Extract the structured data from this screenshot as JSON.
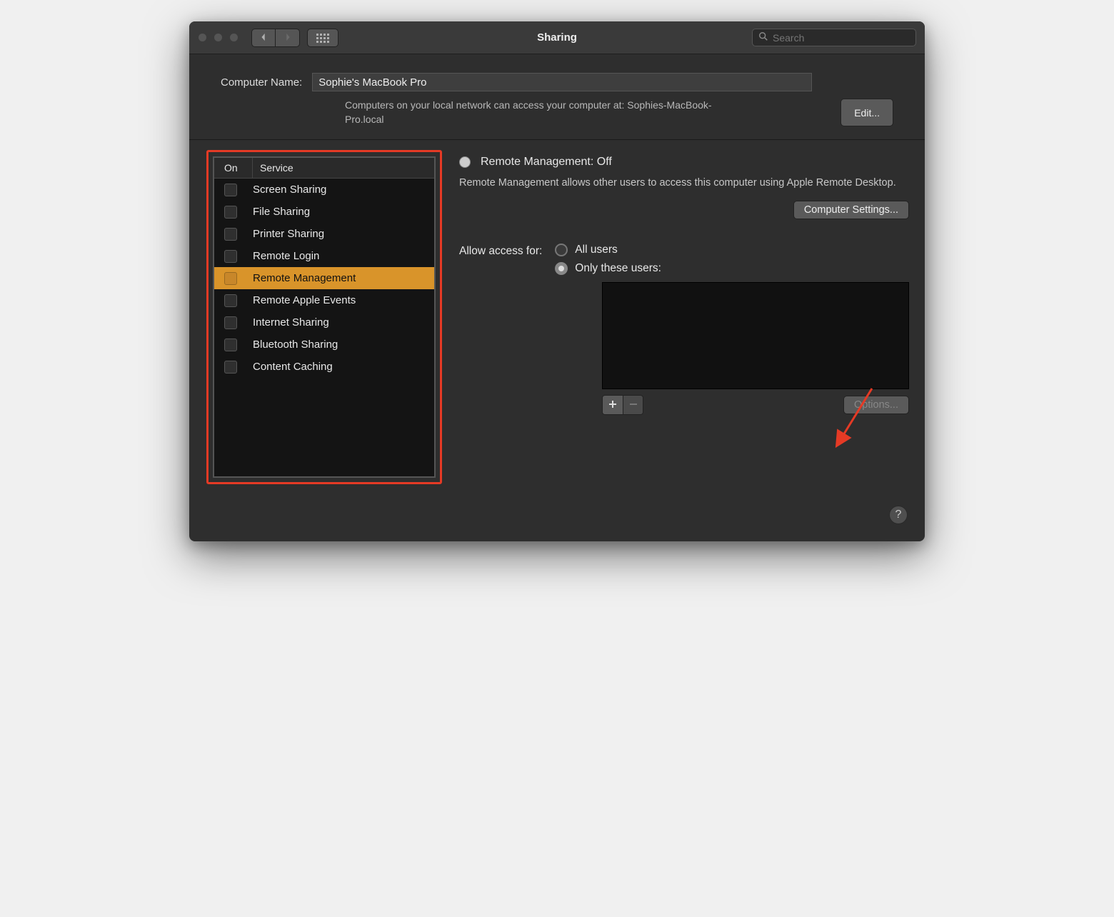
{
  "titlebar": {
    "title": "Sharing",
    "search_placeholder": "Search"
  },
  "header": {
    "computer_name_label": "Computer Name:",
    "computer_name_value": "Sophie's MacBook Pro",
    "subtext": "Computers on your local network can access your computer at: Sophies-MacBook-Pro.local",
    "edit_label": "Edit..."
  },
  "services": {
    "col_on": "On",
    "col_service": "Service",
    "items": [
      {
        "label": "Screen Sharing",
        "on": false,
        "selected": false
      },
      {
        "label": "File Sharing",
        "on": false,
        "selected": false
      },
      {
        "label": "Printer Sharing",
        "on": false,
        "selected": false
      },
      {
        "label": "Remote Login",
        "on": false,
        "selected": false
      },
      {
        "label": "Remote Management",
        "on": false,
        "selected": true
      },
      {
        "label": "Remote Apple Events",
        "on": false,
        "selected": false
      },
      {
        "label": "Internet Sharing",
        "on": false,
        "selected": false
      },
      {
        "label": "Bluetooth Sharing",
        "on": false,
        "selected": false
      },
      {
        "label": "Content Caching",
        "on": false,
        "selected": false
      }
    ]
  },
  "detail": {
    "status_title": "Remote Management: Off",
    "description": "Remote Management allows other users to access this computer using Apple Remote Desktop.",
    "computer_settings_label": "Computer Settings...",
    "access_label": "Allow access for:",
    "radio_all": "All users",
    "radio_only": "Only these users:",
    "options_label": "Options..."
  },
  "colors": {
    "selection": "#d9942a",
    "annotation": "#e53a25"
  }
}
